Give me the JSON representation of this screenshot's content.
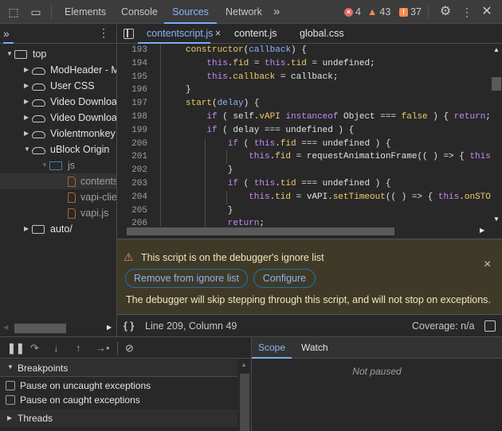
{
  "toolbar": {
    "tabs": [
      "Elements",
      "Console",
      "Sources",
      "Network"
    ],
    "active": "Sources",
    "more": "»",
    "errors": "4",
    "warnings": "43",
    "issues": "37"
  },
  "file_tabs": [
    {
      "label": "contentscript.js",
      "active": true,
      "close": "×"
    },
    {
      "label": "content.js"
    },
    {
      "label": "global.css"
    }
  ],
  "navigator": {
    "more": "»",
    "items": [
      {
        "label": "top",
        "type": "frame",
        "level": 0,
        "expanded": true
      },
      {
        "label": "ModHeader - Modify HTTP headers",
        "type": "cloud",
        "level": 1
      },
      {
        "label": "User CSS",
        "type": "cloud",
        "level": 1
      },
      {
        "label": "Video Downloader",
        "type": "cloud",
        "level": 1
      },
      {
        "label": "Video Downloader",
        "type": "cloud",
        "level": 1
      },
      {
        "label": "Violentmonkey",
        "type": "cloud",
        "level": 1
      },
      {
        "label": "uBlock Origin",
        "type": "cloud",
        "level": 1,
        "expanded": true
      },
      {
        "label": "js",
        "type": "folder",
        "level": 2,
        "expanded": true
      },
      {
        "label": "contentscript.js",
        "type": "file",
        "level": 3,
        "selected": true
      },
      {
        "label": "vapi-client.js",
        "type": "file",
        "level": 3
      },
      {
        "label": "vapi.js",
        "type": "file",
        "level": 3
      },
      {
        "label": "auto/",
        "type": "frame",
        "level": 1
      }
    ]
  },
  "code_lines": [
    {
      "n": "193",
      "i": 1,
      "tk": [
        [
          "constructor",
          "p"
        ],
        [
          "(",
          "t"
        ],
        [
          "callback",
          "v"
        ],
        [
          ") {",
          "t"
        ]
      ]
    },
    {
      "n": "194",
      "i": 2,
      "tk": [
        [
          "this",
          "k"
        ],
        [
          ".",
          "t"
        ],
        [
          "fid",
          "p"
        ],
        [
          " = ",
          "t"
        ],
        [
          "this",
          "k"
        ],
        [
          ".",
          "t"
        ],
        [
          "tid",
          "p"
        ],
        [
          " = undefined;",
          "t"
        ]
      ]
    },
    {
      "n": "195",
      "i": 2,
      "tk": [
        [
          "this",
          "k"
        ],
        [
          ".",
          "t"
        ],
        [
          "callback",
          "p"
        ],
        [
          " = callback;",
          "t"
        ]
      ]
    },
    {
      "n": "196",
      "i": 1,
      "tk": [
        [
          "}",
          "t"
        ]
      ]
    },
    {
      "n": "197",
      "i": 1,
      "tk": [
        [
          "start",
          "p"
        ],
        [
          "(",
          "t"
        ],
        [
          "delay",
          "v"
        ],
        [
          ") {",
          "t"
        ]
      ]
    },
    {
      "n": "198",
      "i": 2,
      "tk": [
        [
          "if",
          "k"
        ],
        [
          " ( self.",
          "t"
        ],
        [
          "vAPI",
          "p"
        ],
        [
          " ",
          "t"
        ],
        [
          "instanceof",
          "k"
        ],
        [
          " Object === ",
          "t"
        ],
        [
          "false",
          "p"
        ],
        [
          " ) { ",
          "t"
        ],
        [
          "return",
          "k"
        ],
        [
          ";",
          "t"
        ]
      ]
    },
    {
      "n": "199",
      "i": 2,
      "tk": [
        [
          "if",
          "k"
        ],
        [
          " ( delay === undefined ) {",
          "t"
        ]
      ]
    },
    {
      "n": "200",
      "i": 3,
      "tk": [
        [
          "if",
          "k"
        ],
        [
          " ( ",
          "t"
        ],
        [
          "this",
          "k"
        ],
        [
          ".",
          "t"
        ],
        [
          "fid",
          "p"
        ],
        [
          " === undefined ) {",
          "t"
        ]
      ]
    },
    {
      "n": "201",
      "i": 4,
      "tk": [
        [
          "this",
          "k"
        ],
        [
          ".",
          "t"
        ],
        [
          "fid",
          "p"
        ],
        [
          " = requestAnimationFrame(( ) => { ",
          "t"
        ],
        [
          "this",
          "k"
        ]
      ]
    },
    {
      "n": "202",
      "i": 3,
      "tk": [
        [
          "}",
          "t"
        ]
      ]
    },
    {
      "n": "203",
      "i": 3,
      "tk": [
        [
          "if",
          "k"
        ],
        [
          " ( ",
          "t"
        ],
        [
          "this",
          "k"
        ],
        [
          ".",
          "t"
        ],
        [
          "tid",
          "p"
        ],
        [
          " === undefined ) {",
          "t"
        ]
      ]
    },
    {
      "n": "204",
      "i": 4,
      "tk": [
        [
          "this",
          "k"
        ],
        [
          ".",
          "t"
        ],
        [
          "tid",
          "p"
        ],
        [
          " = vAPI.",
          "t"
        ],
        [
          "setTimeout",
          "p"
        ],
        [
          "(( ) => { ",
          "t"
        ],
        [
          "this",
          "k"
        ],
        [
          ".",
          "t"
        ],
        [
          "onSTO",
          "p"
        ]
      ]
    },
    {
      "n": "205",
      "i": 3,
      "tk": [
        [
          "}",
          "t"
        ]
      ]
    },
    {
      "n": "206",
      "i": 3,
      "tk": [
        [
          "return",
          "k"
        ],
        [
          ";",
          "t"
        ]
      ]
    }
  ],
  "infobar": {
    "title": "This script is on the debugger's ignore list",
    "remove": "Remove from ignore list",
    "configure": "Configure",
    "detail": "The debugger will skip stepping through this script, and will not stop on exceptions.",
    "close": "×"
  },
  "status": {
    "pretty": "{ }",
    "position": "Line 209, Column 49",
    "coverage": "Coverage: n/a"
  },
  "breakpoints": {
    "title": "Breakpoints",
    "uncaught": "Pause on uncaught exceptions",
    "caught": "Pause on caught exceptions",
    "threads": "Threads"
  },
  "scope": {
    "tabs": [
      "Scope",
      "Watch"
    ],
    "empty": "Not paused"
  },
  "colors": {
    "accent": "#7cacf8",
    "error": "#e46962",
    "warning": "#f28b50",
    "issue": "#f28b50"
  }
}
